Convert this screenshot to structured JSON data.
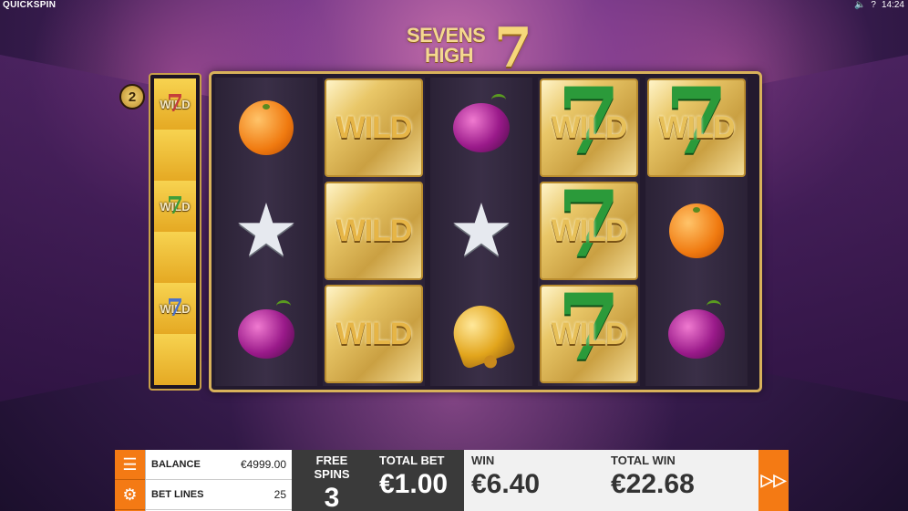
{
  "topbar": {
    "brand": "QUICKSPIN",
    "time": "14:24",
    "sound_icon": "speaker-icon",
    "help_label": "?"
  },
  "logo": {
    "line1": "SEVENS",
    "line2": "HIGH",
    "seven": "7"
  },
  "multiplier": {
    "value": "2"
  },
  "side_reel": {
    "cells": [
      {
        "type": "wild7",
        "wild": "WILD",
        "seven": "7",
        "color": "#c0303a"
      },
      {
        "type": "wild7",
        "wild": "WILD",
        "seven": "7",
        "color": "#2b9a3a"
      },
      {
        "type": "wild7",
        "wild": "WILD",
        "seven": "7",
        "color": "#3a6ad8"
      }
    ]
  },
  "reels": [
    [
      "orange",
      "star",
      "plum"
    ],
    [
      "WILD",
      "WILD",
      "WILD"
    ],
    [
      "plum",
      "star",
      "bell"
    ],
    [
      "WILD7",
      "WILD7",
      "WILD7"
    ],
    [
      "WILD7",
      "orange",
      "plum"
    ]
  ],
  "symbol_text": {
    "wild": "WILD",
    "seven": "7",
    "star": "★"
  },
  "hud": {
    "balance_label": "BALANCE",
    "balance_value": "€4999.00",
    "betlines_label": "BET LINES",
    "betlines_value": "25",
    "freespins_label": "FREE SPINS",
    "freespins_value": "3",
    "totalbet_label": "TOTAL BET",
    "totalbet_value": "€1.00",
    "win_label": "WIN",
    "win_value": "€6.40",
    "totalwin_label": "TOTAL WIN",
    "totalwin_value": "€22.68",
    "menu_icon": "hamburger-icon",
    "settings_icon": "gear-icon",
    "fastforward_icon": "fast-forward-icon",
    "accent": "#f47a14"
  }
}
